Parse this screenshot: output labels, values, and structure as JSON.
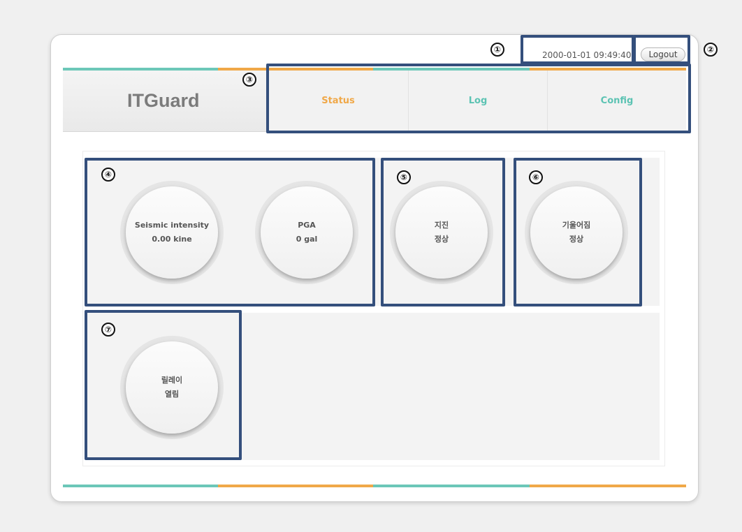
{
  "header": {
    "datetime": "2000-01-01 09:49:40",
    "logout_label": "Logout",
    "logo": "ITGuard"
  },
  "nav": {
    "tabs": [
      {
        "label": "Status",
        "color": "#f0a848"
      },
      {
        "label": "Log",
        "color": "#5cc3b3"
      },
      {
        "label": "Config",
        "color": "#5cc3b3"
      }
    ]
  },
  "colors": {
    "teal": "#6cc7b8",
    "orange": "#f0a848",
    "callout": "#344f7c"
  },
  "gauges": {
    "seismic": {
      "label": "Seismic intensity",
      "value": "0.00 kine"
    },
    "pga": {
      "label": "PGA",
      "value": "0 gal"
    },
    "earthquake": {
      "label": "지진",
      "value": "정상"
    },
    "tilt": {
      "label": "기울어짐",
      "value": "정상"
    },
    "relay": {
      "label": "릴레이",
      "value": "열림"
    }
  },
  "callouts": [
    "①",
    "②",
    "③",
    "④",
    "⑤",
    "⑥",
    "⑦"
  ]
}
